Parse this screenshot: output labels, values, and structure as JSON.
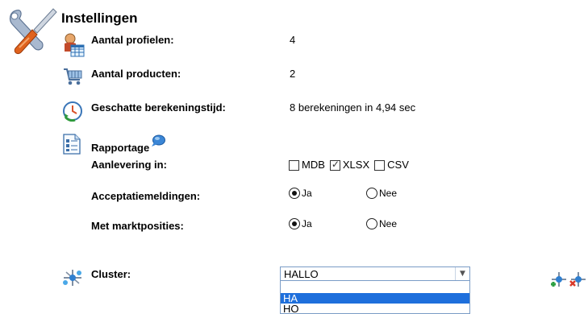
{
  "header": {
    "title": "Instellingen",
    "icon": "tools-icon"
  },
  "settings": {
    "profiles": {
      "label": "Aantal profielen:",
      "value": "4",
      "icon": "profile-table-icon"
    },
    "products": {
      "label": "Aantal producten:",
      "value": "2",
      "icon": "shopping-cart-icon"
    },
    "calc_time": {
      "label": "Geschatte berekeningstijd:",
      "value": "8 berekeningen in 4,94 sec",
      "icon": "clock-refresh-icon"
    }
  },
  "report": {
    "title": "Rapportage",
    "icon": "document-icon",
    "info_icon": "info-bubble-icon",
    "delivery": {
      "label": "Aanlevering in:",
      "options": [
        {
          "label": "MDB",
          "checked": false
        },
        {
          "label": "XLSX",
          "checked": true
        },
        {
          "label": "CSV",
          "checked": false
        }
      ]
    },
    "acceptance": {
      "label": "Acceptatiemeldingen:",
      "yes_label": "Ja",
      "no_label": "Nee",
      "selected": "Ja"
    },
    "market": {
      "label": "Met marktposities:",
      "yes_label": "Ja",
      "no_label": "Nee",
      "selected": "Ja"
    }
  },
  "cluster": {
    "label": "Cluster:",
    "icon": "cluster-network-icon",
    "selected": "HALLO",
    "options": [
      "",
      "HA",
      "HO"
    ],
    "highlighted": "HA",
    "actions": [
      {
        "name": "add-cluster-icon"
      },
      {
        "name": "remove-cluster-icon"
      }
    ]
  },
  "colors": {
    "highlight": "#1e6fdc",
    "select_border": "#7a9cc6"
  }
}
